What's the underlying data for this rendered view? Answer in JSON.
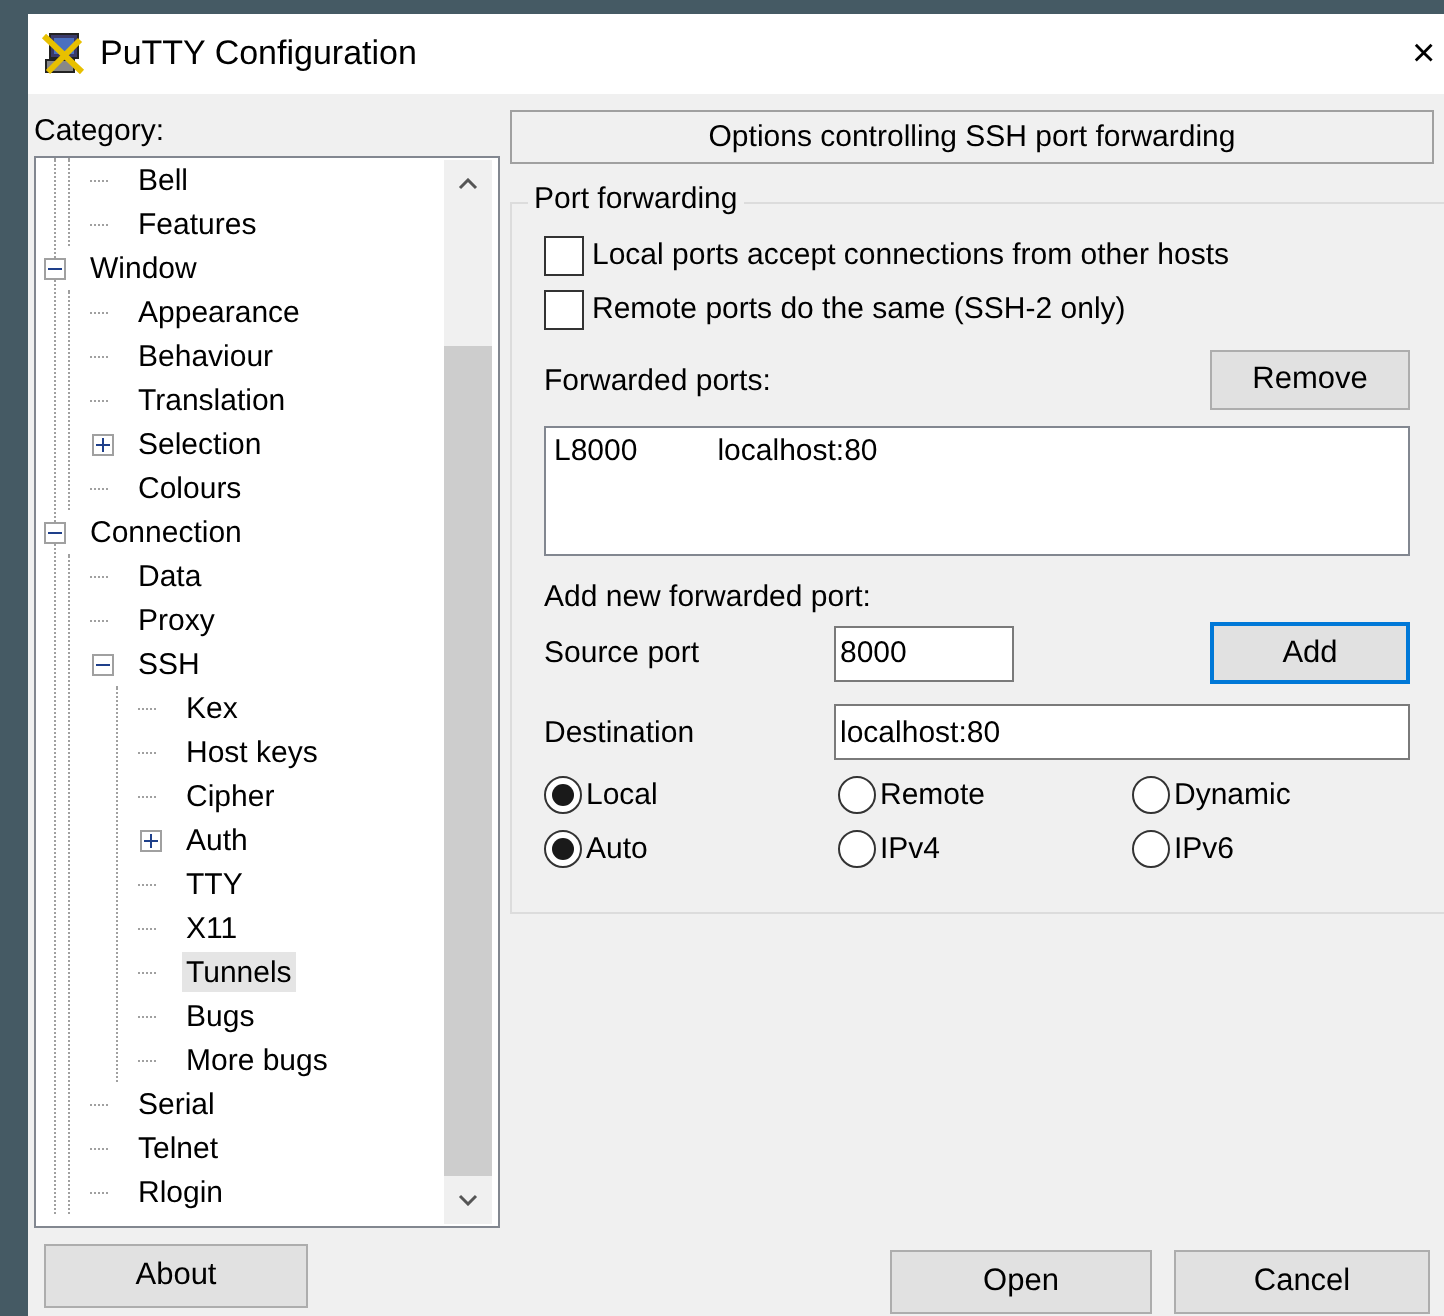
{
  "window": {
    "title": "PuTTY Configuration",
    "close": "×"
  },
  "category_label": "Category:",
  "tree": [
    {
      "children": [
        {
          "label": "Bell",
          "selected": false
        },
        {
          "label": "Features",
          "selected": false
        }
      ]
    },
    {
      "label": "Window",
      "selected": false,
      "expanded": true,
      "children": [
        {
          "label": "Appearance",
          "selected": false
        },
        {
          "label": "Behaviour",
          "selected": false
        },
        {
          "label": "Translation",
          "selected": false
        },
        {
          "label": "Selection",
          "selected": false,
          "expanded": false
        },
        {
          "label": "Colours",
          "selected": false
        }
      ]
    },
    {
      "label": "Connection",
      "selected": false,
      "expanded": true,
      "children": [
        {
          "label": "Data",
          "selected": false
        },
        {
          "label": "Proxy",
          "selected": false
        },
        {
          "label": "SSH",
          "selected": false,
          "expanded": true,
          "children": [
            {
              "label": "Kex",
              "selected": false
            },
            {
              "label": "Host keys",
              "selected": false
            },
            {
              "label": "Cipher",
              "selected": false
            },
            {
              "label": "Auth",
              "selected": false,
              "expanded": false
            },
            {
              "label": "TTY",
              "selected": false
            },
            {
              "label": "X11",
              "selected": false
            },
            {
              "label": "Tunnels",
              "selected": true
            },
            {
              "label": "Bugs",
              "selected": false
            },
            {
              "label": "More bugs",
              "selected": false
            }
          ]
        },
        {
          "label": "Serial",
          "selected": false
        },
        {
          "label": "Telnet",
          "selected": false
        },
        {
          "label": "Rlogin",
          "selected": false
        }
      ]
    }
  ],
  "panel_header": "Options controlling SSH port forwarding",
  "group_title": "Port forwarding",
  "checkboxes": [
    {
      "label": "Local ports accept connections from other hosts",
      "checked": false
    },
    {
      "label": "Remote ports do the same (SSH-2 only)",
      "checked": false
    }
  ],
  "forwarded_ports_label": "Forwarded ports:",
  "remove_button": "Remove",
  "forwarded_ports": [
    {
      "port": "L8000",
      "destination": "localhost:80"
    }
  ],
  "add_label": "Add new forwarded port:",
  "source_port": {
    "label": "Source port",
    "value": "8000"
  },
  "add_button": {
    "label": "Add",
    "focused": true
  },
  "destination": {
    "label": "Destination",
    "value": "localhost:80"
  },
  "radio_groups": [
    {
      "options": [
        {
          "label": "Local",
          "selected": true
        },
        {
          "label": "Remote",
          "selected": false
        },
        {
          "label": "Dynamic",
          "selected": false
        }
      ]
    },
    {
      "options": [
        {
          "label": "Auto",
          "selected": true
        },
        {
          "label": "IPv4",
          "selected": false
        },
        {
          "label": "IPv6",
          "selected": false
        }
      ]
    }
  ],
  "buttons": {
    "about": "About",
    "open": "Open",
    "cancel": "Cancel"
  }
}
